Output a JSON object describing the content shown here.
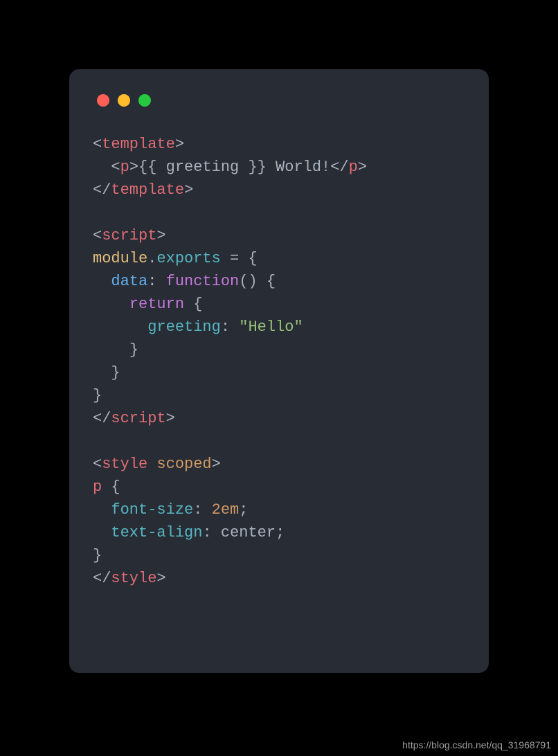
{
  "traffic_lights": {
    "red": "#ff5f56",
    "yellow": "#ffbd2e",
    "green": "#27c93f"
  },
  "code": {
    "line1": {
      "lt": "<",
      "tag": "template",
      "gt": ">"
    },
    "line2": {
      "indent": "  ",
      "lt": "<",
      "tag_open": "p",
      "gt1": ">",
      "expr": "{{ greeting }} World!",
      "lt2": "</",
      "tag_close": "p",
      "gt2": ">"
    },
    "line3": {
      "lt": "</",
      "tag": "template",
      "gt": ">"
    },
    "line4": "",
    "line5": {
      "lt": "<",
      "tag": "script",
      "gt": ">"
    },
    "line6": {
      "mod": "module",
      "dot": ".",
      "exp": "exports",
      "rest": " = {"
    },
    "line7": {
      "indent": "  ",
      "prop": "data",
      "colon": ": ",
      "kw": "function",
      "paren": "() {"
    },
    "line8": {
      "indent": "    ",
      "kw": "return",
      "brace": " {"
    },
    "line9": {
      "indent": "      ",
      "prop": "greeting",
      "colon": ": ",
      "str": "\"Hello\""
    },
    "line10": {
      "indent": "    ",
      "brace": "}"
    },
    "line11": {
      "indent": "  ",
      "brace": "}"
    },
    "line12": {
      "brace": "}"
    },
    "line13": {
      "lt": "</",
      "tag": "script",
      "gt": ">"
    },
    "line14": "",
    "line15": {
      "lt": "<",
      "tag": "style",
      "sp": " ",
      "attr": "scoped",
      "gt": ">"
    },
    "line16": {
      "sel": "p",
      "brace": " {"
    },
    "line17": {
      "indent": "  ",
      "prop": "font-size",
      "colon": ": ",
      "val": "2em",
      "semi": ";"
    },
    "line18": {
      "indent": "  ",
      "prop": "text-align",
      "colon": ": ",
      "val": "center",
      "semi": ";"
    },
    "line19": {
      "brace": "}"
    },
    "line20": {
      "lt": "</",
      "tag": "style",
      "gt": ">"
    }
  },
  "watermark": "https://blog.csdn.net/qq_31968791"
}
